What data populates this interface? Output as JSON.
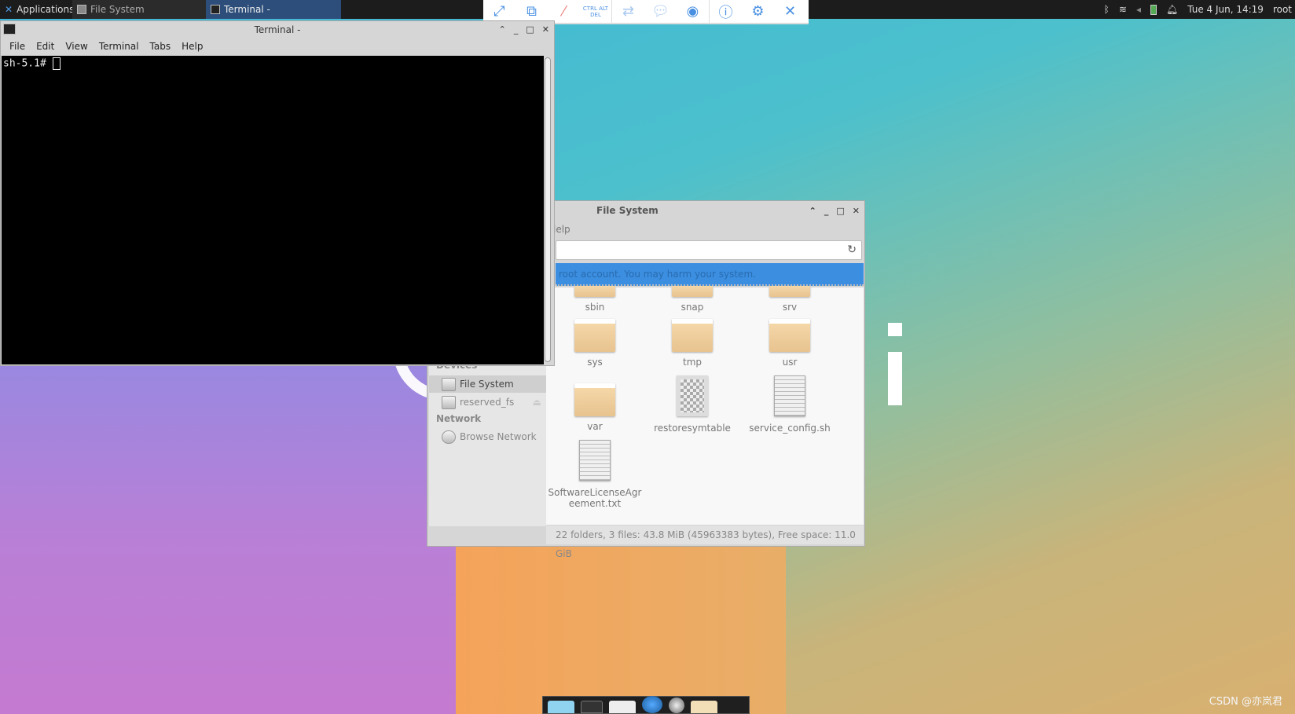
{
  "panel": {
    "apps": "Applications :",
    "tasks": [
      {
        "label": "File System"
      },
      {
        "label": "Terminal -"
      }
    ],
    "clock": "Tue  4 Jun, 14:19",
    "user": "root"
  },
  "remote_toolbar": {
    "icons": [
      "fullscreen-icon",
      "fit-screen-icon",
      "mute-icon",
      "ctrl-alt-del-icon",
      "clipboard-icon",
      "chat-icon",
      "record-icon",
      "info-icon",
      "settings-icon",
      "close-icon"
    ],
    "ctrl_alt_del": "CTRL ALT DEL"
  },
  "terminal": {
    "title": "Terminal -",
    "menu": [
      "File",
      "Edit",
      "View",
      "Terminal",
      "Tabs",
      "Help"
    ],
    "prompt": "sh-5.1#"
  },
  "file_manager": {
    "title": "File System",
    "menu_partial": "lelp",
    "warning": "root account. You may harm your system.",
    "sidebar": {
      "devices_header": "Devices",
      "devices": [
        "File System",
        "reserved_fs"
      ],
      "network_header": "Network",
      "network": [
        "Browse Network"
      ]
    },
    "items": [
      {
        "name": "sbin",
        "type": "folder"
      },
      {
        "name": "snap",
        "type": "folder"
      },
      {
        "name": "srv",
        "type": "folder"
      },
      {
        "name": "sys",
        "type": "folder"
      },
      {
        "name": "tmp",
        "type": "folder"
      },
      {
        "name": "usr",
        "type": "folder"
      },
      {
        "name": "var",
        "type": "folder"
      },
      {
        "name": "restoresymtable",
        "type": "binary"
      },
      {
        "name": "service_config.sh",
        "type": "script"
      },
      {
        "name": "SoftwareLicenseAgreement.txt",
        "type": "text"
      }
    ],
    "status": "22 folders, 3 files: 43.8 MiB (45963383 bytes), Free space: 11.0 GiB"
  },
  "watermark": "CSDN @亦岚君"
}
